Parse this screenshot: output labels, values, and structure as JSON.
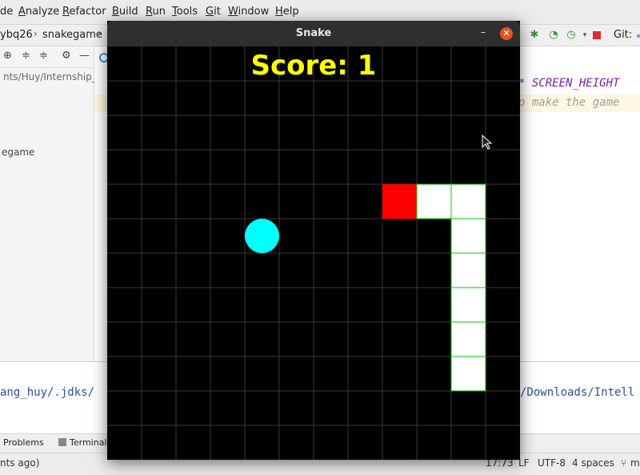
{
  "menu": [
    "de",
    "Analyze",
    "Refactor",
    "Build",
    "Run",
    "Tools",
    "Git",
    "Window",
    "Help"
  ],
  "breadcrumb": [
    "ybq26",
    "snakegame"
  ],
  "toolbar": {
    "git_label": "Git:"
  },
  "project": {
    "path": "nts/Huy/Internship_",
    "node": "egame"
  },
  "editor": {
    "line1_code": "* SCREEN_HEIGHT",
    "line2_comment": "o make the game"
  },
  "console": {
    "left_text": "ang_huy/.jdks/",
    "right_text": "/Downloads/Intell"
  },
  "tool_tabs": [
    "Problems",
    "Terminal"
  ],
  "status": {
    "left": "nts ago)",
    "position": "17:73",
    "line_sep": "LF",
    "encoding": "UTF-8",
    "indent": "4 spaces",
    "extra": "m"
  },
  "snake_window": {
    "title": "Snake",
    "score_label": "Score:",
    "score_value": "1"
  },
  "game": {
    "grid_size": 12,
    "snake_cells": [
      [
        8,
        4
      ],
      [
        9,
        4
      ],
      [
        10,
        4
      ],
      [
        10,
        5
      ],
      [
        10,
        6
      ],
      [
        10,
        7
      ],
      [
        10,
        8
      ],
      [
        10,
        9
      ]
    ],
    "head_cell": [
      8,
      4
    ],
    "food_cell": [
      4,
      5
    ],
    "colors": {
      "background": "#000000",
      "grid": "#3a3a3a",
      "head": "#ff0000",
      "body": "#ffffff",
      "body_outline": "#00cc00",
      "food": "#00ffff",
      "score": "#ffff00"
    }
  }
}
